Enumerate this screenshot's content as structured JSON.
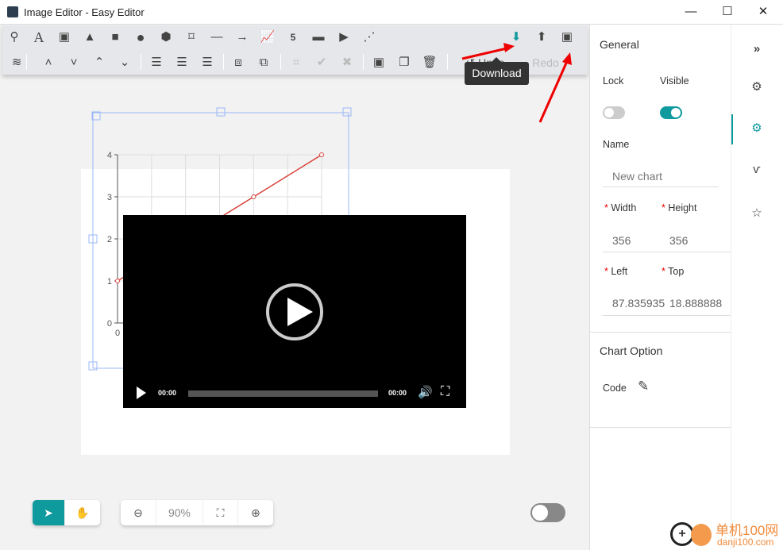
{
  "window": {
    "title": "Image Editor - Easy Editor",
    "minimize": "—",
    "maximize": "☐",
    "close": "✕"
  },
  "toolbar": {
    "row1": [
      "map-marker",
      "text",
      "image",
      "triangle",
      "rectangle",
      "circle",
      "cube",
      "polygon",
      "line",
      "arrow",
      "chart",
      "html5",
      "window",
      "video",
      "bezier"
    ],
    "row2": [
      "layers",
      "bring-forward",
      "send-backward",
      "bring-to-front",
      "send-to-back",
      "align-left",
      "align-center",
      "align-right",
      "group",
      "ungroup",
      "crop",
      "confirm",
      "cancel",
      "image",
      "duplicate",
      "delete"
    ],
    "undo": "Undo",
    "redo": "Redo",
    "download_tooltip": "Download",
    "right_icons": [
      "download",
      "upload",
      "export-image"
    ]
  },
  "chart_data": {
    "type": "line",
    "x": [
      0,
      4,
      6
    ],
    "y": [
      1,
      3,
      4
    ],
    "xlim": [
      0,
      6
    ],
    "ylim": [
      0,
      4
    ],
    "yticks": [
      "0",
      "1",
      "2",
      "3",
      "4"
    ],
    "xticks": [
      "0"
    ],
    "grid": true,
    "color": "#d9423b"
  },
  "video": {
    "current": "00:00",
    "duration": "00:00"
  },
  "panel": {
    "general": "General",
    "lock": "Lock",
    "visible": "Visible",
    "lock_on": false,
    "visible_on": true,
    "name_label": "Name",
    "name_placeholder": "New chart",
    "width_label": "Width",
    "height_label": "Height",
    "width": "356",
    "height": "356",
    "left_label": "Left",
    "top_label": "Top",
    "left": "87.835935",
    "top": "18.888888",
    "chart_option": "Chart Option",
    "code_label": "Code"
  },
  "rail": [
    "expand",
    "settings",
    "advanced-settings",
    "vine",
    "star"
  ],
  "bottom": {
    "zoom": "90%",
    "toggle_on": false
  },
  "watermark": {
    "cn": "单机100网",
    "url": "danji100.com"
  },
  "accent": "#0f9a9e"
}
